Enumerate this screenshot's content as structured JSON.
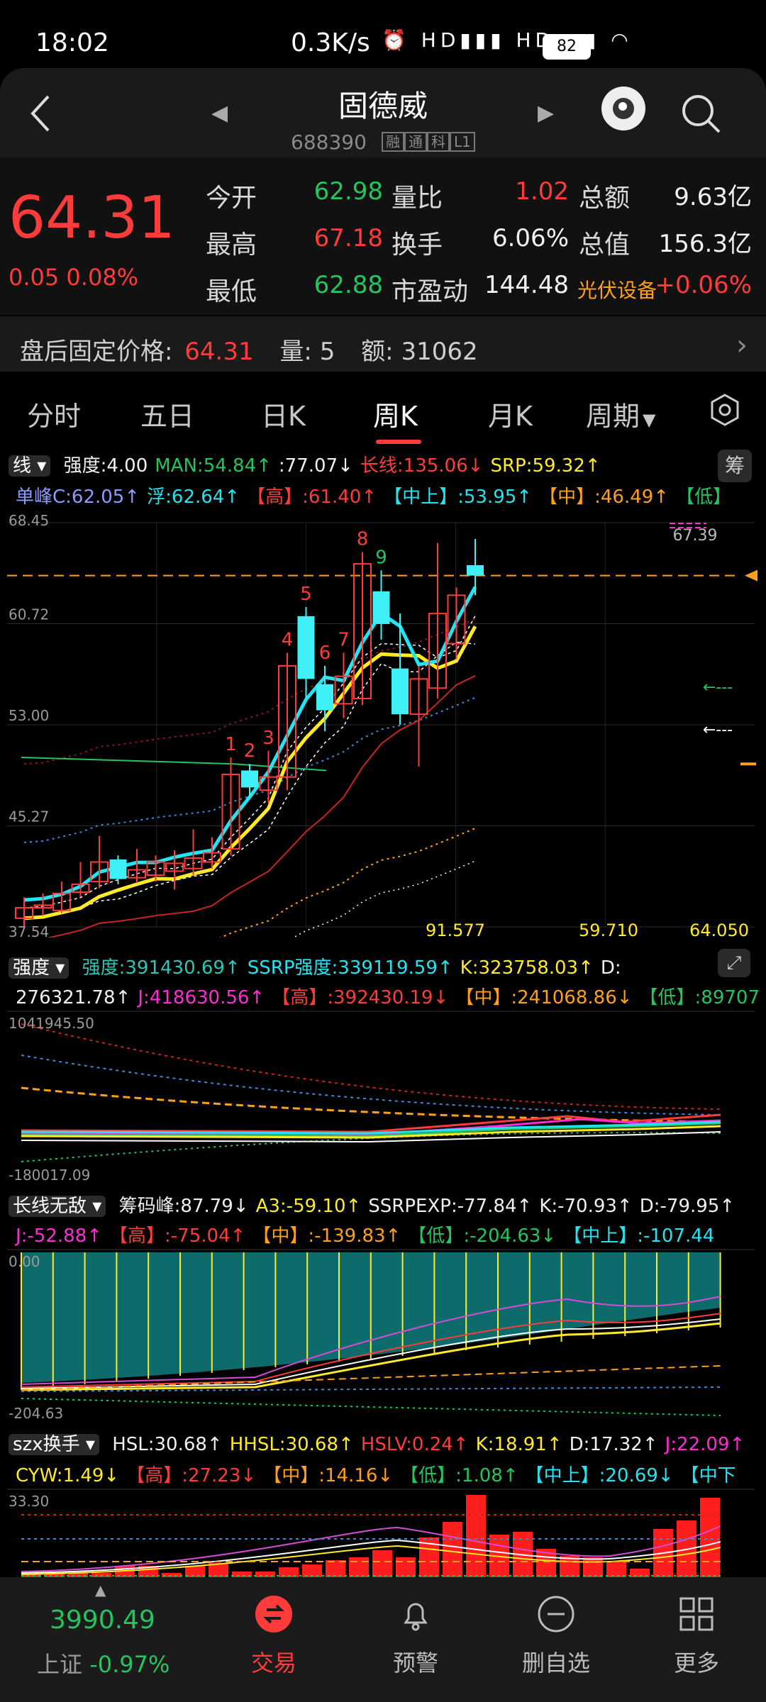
{
  "status_bar": {
    "time": "18:02",
    "speed": "0.3K/s",
    "icons": "⏰ HD▮▮▮ HD▮▮▮ ◠",
    "battery": "82"
  },
  "header": {
    "title": "固德威",
    "code": "688390",
    "tags": [
      "融",
      "通",
      "科",
      "L1"
    ]
  },
  "quote": {
    "price": "64.31",
    "change": "0.05 0.08%",
    "fields": [
      {
        "label": "今开",
        "value": "62.98",
        "color": "green"
      },
      {
        "label": "量比",
        "value": "1.02",
        "color": "red"
      },
      {
        "label": "总额",
        "value": "9.63亿",
        "color": "white"
      },
      {
        "label": "最高",
        "value": "67.18",
        "color": "red"
      },
      {
        "label": "换手",
        "value": "6.06%",
        "color": "white"
      },
      {
        "label": "总值",
        "value": "156.3亿",
        "color": "white"
      },
      {
        "label": "最低",
        "value": "62.88",
        "color": "green"
      },
      {
        "label": "市盈动",
        "value": "144.48",
        "color": "white"
      },
      {
        "label": "光伏设备",
        "value": "+0.06%",
        "color": "red"
      }
    ]
  },
  "after_hours": {
    "label": "盘后固定价格:",
    "price": "64.31",
    "vol_label": "量:",
    "vol": "5",
    "amt_label": "额:",
    "amt": "31062"
  },
  "tabs": [
    "分时",
    "五日",
    "日K",
    "周K",
    "月K",
    "周期"
  ],
  "main_indicator": {
    "selector": "线",
    "line1": [
      {
        "t": "强度:4.00",
        "c": "white"
      },
      {
        "t": "MAN:54.84↑",
        "c": "green"
      },
      {
        "t": ":77.07↓",
        "c": "white"
      },
      {
        "t": "长线:135.06↓",
        "c": "red"
      },
      {
        "t": "SRP:59.32↑",
        "c": "yellow"
      }
    ],
    "line2": [
      {
        "t": "单峰C:62.05↑",
        "c": "blue"
      },
      {
        "t": "浮:62.64↑",
        "c": "cyan"
      },
      {
        "t": "【高】:61.40↑",
        "c": "red"
      },
      {
        "t": "【中上】:53.95↑",
        "c": "cyan"
      },
      {
        "t": "【中】:46.49↑",
        "c": "orange"
      },
      {
        "t": "【低】",
        "c": "green"
      }
    ],
    "chip_label": "筹",
    "y_labels": [
      "68.45",
      "60.72",
      "53.00",
      "45.27",
      "37.54"
    ],
    "x_bottom_labels": [
      "91.577",
      "59.710",
      "64.050"
    ],
    "top_right_label": "67.39",
    "candle_numbers": [
      "1",
      "2",
      "3",
      "4",
      "5",
      "6",
      "7",
      "8",
      "9"
    ]
  },
  "panel2": {
    "selector": "强度",
    "line1": [
      {
        "t": "强度:391430.69↑",
        "c": "teal"
      },
      {
        "t": "SSRP强度:339119.59↑",
        "c": "cyan"
      },
      {
        "t": "K:323758.03↑",
        "c": "yellow"
      },
      {
        "t": "D:",
        "c": "white"
      }
    ],
    "line2": [
      {
        "t": "276321.78↑",
        "c": "white"
      },
      {
        "t": "J:418630.56↑",
        "c": "magenta"
      },
      {
        "t": "【高】:392430.19↓",
        "c": "red"
      },
      {
        "t": "【中】:241068.86↓",
        "c": "orange"
      },
      {
        "t": "【低】:89707",
        "c": "green"
      }
    ],
    "y_top": "1041945.50",
    "y_bottom": "-180017.09"
  },
  "panel3": {
    "selector": "长线无敌",
    "line1": [
      {
        "t": "筹码峰:87.79↓",
        "c": "white"
      },
      {
        "t": "A3:-59.10↑",
        "c": "yellow"
      },
      {
        "t": "SSRPEXP:-77.84↑",
        "c": "white"
      },
      {
        "t": "K:-70.93↑",
        "c": "white"
      },
      {
        "t": "D:-79.95↑",
        "c": "white"
      }
    ],
    "line2": [
      {
        "t": "J:-52.88↑",
        "c": "magenta"
      },
      {
        "t": "【高】:-75.04↑",
        "c": "red"
      },
      {
        "t": "【中】:-139.83↑",
        "c": "orange"
      },
      {
        "t": "【低】:-204.63↓",
        "c": "green"
      },
      {
        "t": "【中上】:-107.44",
        "c": "cyan"
      }
    ],
    "y_top": "0.00",
    "y_bottom": "-204.63"
  },
  "panel4": {
    "selector": "szx换手",
    "line1": [
      {
        "t": "HSL:30.68↑",
        "c": "white"
      },
      {
        "t": "HHSL:30.68↑",
        "c": "yellow"
      },
      {
        "t": "HSLV:0.24↑",
        "c": "red"
      },
      {
        "t": "K:18.91↑",
        "c": "yellow"
      },
      {
        "t": "D:17.32↑",
        "c": "white"
      },
      {
        "t": "J:22.09↑",
        "c": "magenta"
      }
    ],
    "line2": [
      {
        "t": "CYW:1.49↓",
        "c": "yellow"
      },
      {
        "t": "【高】:27.23↓",
        "c": "red"
      },
      {
        "t": "【中】:14.16↓",
        "c": "orange"
      },
      {
        "t": "【低】:1.08↑",
        "c": "green"
      },
      {
        "t": "【中上】:20.69↓",
        "c": "cyan"
      },
      {
        "t": "【中下",
        "c": "cyan"
      }
    ],
    "y_top": "33.30"
  },
  "bottom_nav": {
    "index_value": "3990.49",
    "index_name": "上证",
    "index_change": "-0.97%",
    "items": [
      "交易",
      "预警",
      "删自选",
      "更多"
    ]
  },
  "colors": {
    "up": "#ff3b3b",
    "down": "#22c55e",
    "cyan_candle": "#3ff0f7",
    "accent": "#ff3b3b"
  },
  "chart_data": {
    "type": "candlestick",
    "period": "weekly",
    "ylim": [
      37.54,
      68.45
    ],
    "candles": [
      {
        "o": 38.2,
        "c": 39.0,
        "h": 39.8,
        "l": 37.6,
        "up": true
      },
      {
        "o": 39.0,
        "c": 39.2,
        "h": 40.1,
        "l": 38.4,
        "up": true
      },
      {
        "o": 38.8,
        "c": 40.1,
        "h": 41.0,
        "l": 38.6,
        "up": true
      },
      {
        "o": 40.2,
        "c": 40.8,
        "h": 42.5,
        "l": 39.8,
        "up": true
      },
      {
        "o": 41.0,
        "c": 42.5,
        "h": 44.5,
        "l": 40.5,
        "up": true
      },
      {
        "o": 42.7,
        "c": 41.2,
        "h": 43.0,
        "l": 40.8,
        "up": false
      },
      {
        "o": 41.3,
        "c": 41.9,
        "h": 43.5,
        "l": 40.9,
        "up": true
      },
      {
        "o": 41.5,
        "c": 42.5,
        "h": 43.0,
        "l": 41.0,
        "up": true
      },
      {
        "o": 41.8,
        "c": 42.4,
        "h": 43.4,
        "l": 40.4,
        "up": true
      },
      {
        "o": 42.0,
        "c": 42.8,
        "h": 45.0,
        "l": 41.5,
        "up": true
      },
      {
        "o": 42.5,
        "c": 43.2,
        "h": 44.4,
        "l": 42.0,
        "up": true
      },
      {
        "o": 43.5,
        "c": 49.2,
        "h": 50.5,
        "l": 43.0,
        "up": true
      },
      {
        "o": 49.5,
        "c": 48.2,
        "h": 50.0,
        "l": 47.5,
        "up": false
      },
      {
        "o": 48.0,
        "c": 49.0,
        "h": 51.0,
        "l": 47.0,
        "up": true
      },
      {
        "o": 49.0,
        "c": 57.5,
        "h": 58.5,
        "l": 48.0,
        "up": true
      },
      {
        "o": 61.3,
        "c": 56.5,
        "h": 62.0,
        "l": 55.0,
        "up": false
      },
      {
        "o": 56.1,
        "c": 54.1,
        "h": 57.5,
        "l": 52.5,
        "up": false
      },
      {
        "o": 54.6,
        "c": 56.7,
        "h": 58.5,
        "l": 53.5,
        "up": true
      },
      {
        "o": 55.0,
        "c": 65.3,
        "h": 66.2,
        "l": 54.5,
        "up": true
      },
      {
        "o": 63.2,
        "c": 60.7,
        "h": 64.8,
        "l": 59.5,
        "up": false
      },
      {
        "o": 57.3,
        "c": 53.8,
        "h": 61.5,
        "l": 53.0,
        "up": false
      },
      {
        "o": 53.8,
        "c": 56.5,
        "h": 57.5,
        "l": 49.8,
        "up": true
      },
      {
        "o": 55.8,
        "c": 61.5,
        "h": 66.9,
        "l": 55.0,
        "up": true
      },
      {
        "o": 59.2,
        "c": 62.9,
        "h": 63.5,
        "l": 58.0,
        "up": true
      },
      {
        "o": 65.2,
        "c": 64.4,
        "h": 67.2,
        "l": 62.9,
        "up": false
      }
    ]
  }
}
